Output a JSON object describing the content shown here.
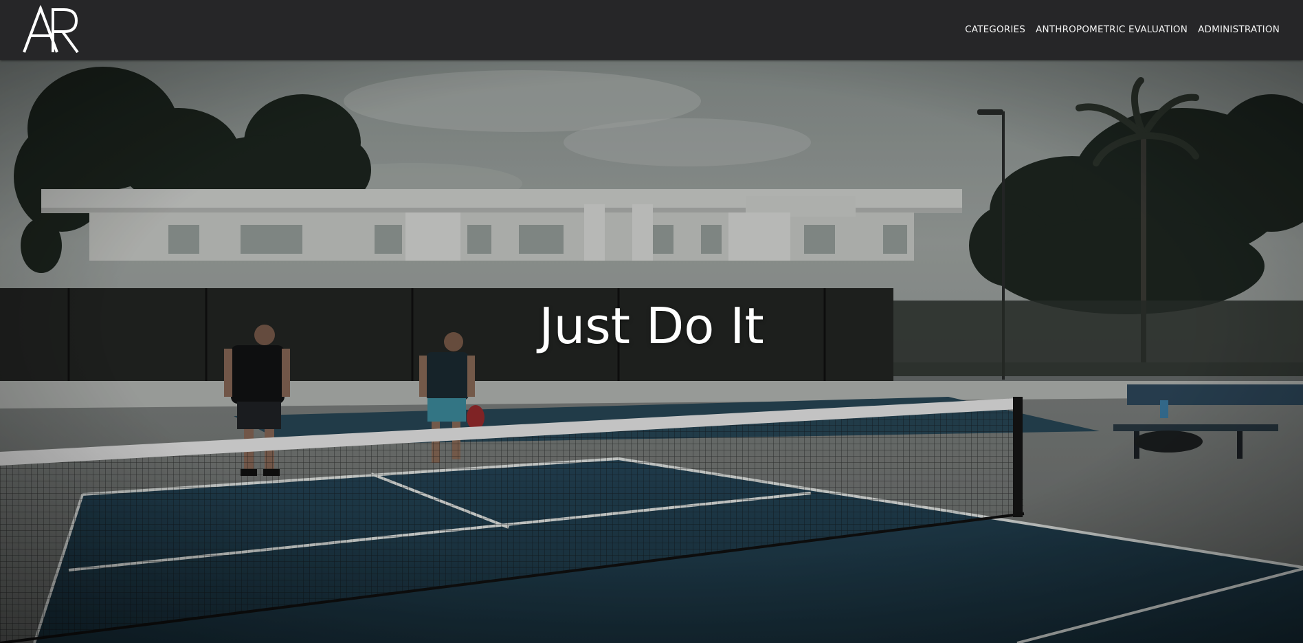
{
  "brand": {
    "logo_text": "AR"
  },
  "nav": {
    "items": [
      {
        "label": "CATEGORIES"
      },
      {
        "label": "ANTHROPOMETRIC EVALUATION"
      },
      {
        "label": "ADMINISTRATION"
      }
    ]
  },
  "hero": {
    "title": "Just Do It",
    "background": "pickleball-court-video"
  },
  "colors": {
    "navbar_bg": "#262628",
    "nav_text": "#f2f2f2",
    "hero_text": "#ffffff",
    "court_blue": "#1f3a48"
  }
}
